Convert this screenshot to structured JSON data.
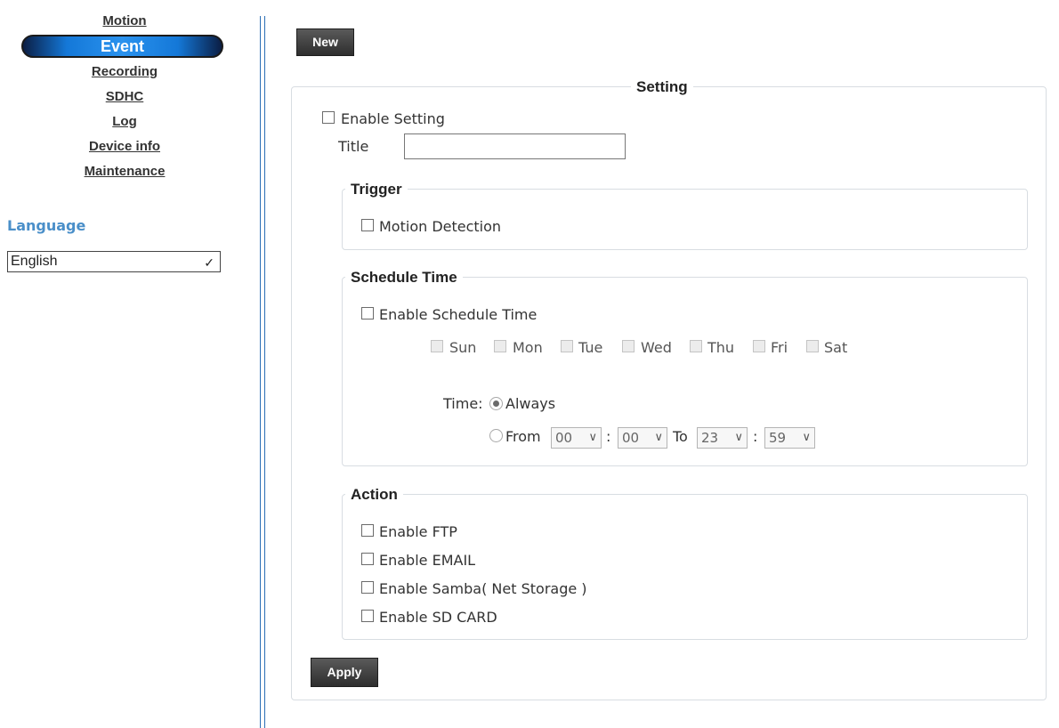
{
  "sidebar": {
    "nav": [
      {
        "label": "Motion"
      },
      {
        "label": "Event",
        "active": true
      },
      {
        "label": "Recording"
      },
      {
        "label": "SDHC"
      },
      {
        "label": "Log"
      },
      {
        "label": "Device info"
      },
      {
        "label": "Maintenance"
      }
    ],
    "language_title": "Language",
    "language_value": "English"
  },
  "toolbar": {
    "new_label": "New"
  },
  "setting": {
    "legend": "Setting",
    "enable_label": "Enable Setting",
    "title_label": "Title",
    "title_value": ""
  },
  "trigger": {
    "legend": "Trigger",
    "motion_label": "Motion Detection"
  },
  "schedule": {
    "legend": "Schedule Time",
    "enable_label": "Enable Schedule Time",
    "days": [
      "Sun",
      "Mon",
      "Tue",
      "Wed",
      "Thu",
      "Fri",
      "Sat"
    ],
    "time_label": "Time:",
    "always_label": "Always",
    "from_label": "From",
    "colon": ":",
    "to_label": "To",
    "from_hour": "00",
    "from_min": "00",
    "to_hour": "23",
    "to_min": "59",
    "selected": "Always"
  },
  "action": {
    "legend": "Action",
    "ftp_label": "Enable FTP",
    "email_label": "Enable EMAIL",
    "samba_label": "Enable Samba( Net Storage )",
    "sd_label": "Enable SD CARD"
  },
  "apply_label": "Apply",
  "colors": {
    "accent": "#1478d8",
    "divider": "#2a6db5",
    "language": "#4a8fc9"
  }
}
